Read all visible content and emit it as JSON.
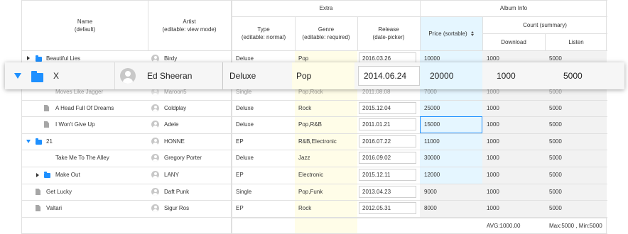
{
  "header": {
    "name": "Name\n(default)",
    "artist": "Artist\n(editable: view mode)",
    "extra": "Extra",
    "type": "Type\n(editable: normal)",
    "genre": "Genre\n(editable: required)",
    "release": "Release\n(date-picker)",
    "album_info": "Album Info",
    "price": "Price (sortable)",
    "count": "Count (summary)",
    "download": "Download",
    "listen": "Listen"
  },
  "rows": [
    {
      "name": "Beautiful Lies",
      "artist": "Birdy",
      "type": "Deluxe",
      "genre": "Pop",
      "release": "2016.03.26",
      "price": "10000",
      "download": "1000",
      "listen": "5000"
    },
    {
      "name": "Moves Like Jagger",
      "artist": "Maroon5",
      "type": "Single",
      "genre": "Pop,Rock",
      "release": "2011.08.08",
      "price": "7000",
      "download": "1000",
      "listen": "5000"
    },
    {
      "name": "A Head Full Of Dreams",
      "artist": "Coldplay",
      "type": "Deluxe",
      "genre": "Rock",
      "release": "2015.12.04",
      "price": "25000",
      "download": "1000",
      "listen": "5000"
    },
    {
      "name": "I Won't Give Up",
      "artist": "Adele",
      "type": "Deluxe",
      "genre": "Pop,R&B",
      "release": "2011.01.21",
      "price": "15000",
      "download": "1000",
      "listen": "5000"
    },
    {
      "name": "21",
      "artist": "HONNE",
      "type": "EP",
      "genre": "R&B,Electronic",
      "release": "2016.07.22",
      "price": "11000",
      "download": "1000",
      "listen": "5000"
    },
    {
      "name": "Take Me To The Alley",
      "artist": "Gregory Porter",
      "type": "Deluxe",
      "genre": "Jazz",
      "release": "2016.09.02",
      "price": "30000",
      "download": "1000",
      "listen": "5000"
    },
    {
      "name": "Make Out",
      "artist": "LANY",
      "type": "EP",
      "genre": "Electronic",
      "release": "2015.12.11",
      "price": "12000",
      "download": "1000",
      "listen": "5000"
    },
    {
      "name": "Get Lucky",
      "artist": "Daft Punk",
      "type": "Single",
      "genre": "Pop,Funk",
      "release": "2013.04.23",
      "price": "9000",
      "download": "1000",
      "listen": "5000"
    },
    {
      "name": "Valtari",
      "artist": "Sigur Ros",
      "type": "EP",
      "genre": "Rock",
      "release": "2012.05.31",
      "price": "8000",
      "download": "1000",
      "listen": "5000"
    }
  ],
  "dragged_row": {
    "name": "X",
    "artist": "Ed Sheeran",
    "type": "Deluxe",
    "genre": "Pop",
    "release": "2014.06.24",
    "price": "20000",
    "download": "1000",
    "listen": "5000"
  },
  "summary": {
    "download": "AVG:1000.00",
    "listen": "Max:5000 , Min:5000"
  },
  "colors": {
    "genre_bg": "#fffde8",
    "price_bg": "#e5f6ff",
    "readonly_bg": "#f2f2f2",
    "accent": "#1e90ff",
    "border": "#e0e0e0"
  },
  "icons": {
    "folder": "folder-icon",
    "file": "file-icon",
    "avatar": "person-icon",
    "sort": "sort-icon"
  }
}
